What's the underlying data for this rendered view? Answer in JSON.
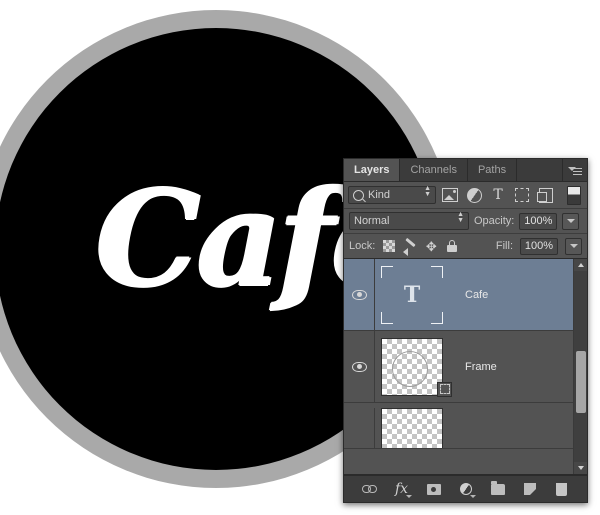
{
  "artwork": {
    "word": "Cafe",
    "ring_color": "#a9a9a9",
    "disc_color": "#000000",
    "text_color": "#ffffff",
    "background": "#ffffff"
  },
  "panel": {
    "tabs": [
      {
        "label": "Layers",
        "active": true
      },
      {
        "label": "Channels",
        "active": false
      },
      {
        "label": "Paths",
        "active": false
      }
    ],
    "menu_icon": "panel-menu-icon",
    "filter": {
      "kind_label": "Kind",
      "search_icon": "search-icon",
      "icons": [
        "pixel-layer-filter-icon",
        "adjustment-layer-filter-icon",
        "type-layer-filter-icon",
        "shape-layer-filter-icon",
        "smart-object-filter-icon"
      ],
      "type_glyph": "T",
      "toggle_icon": "filter-toggle-switch"
    },
    "blend": {
      "mode": "Normal",
      "opacity_label": "Opacity:",
      "opacity_value": "100%"
    },
    "lock": {
      "label": "Lock:",
      "icons": [
        "lock-transparent-pixels-icon",
        "lock-image-pixels-icon",
        "lock-position-icon",
        "lock-all-icon"
      ],
      "fill_label": "Fill:",
      "fill_value": "100%"
    },
    "layers": [
      {
        "name": "Cafe",
        "type": "type-layer",
        "visible": true,
        "selected": true,
        "thumb_glyph": "T"
      },
      {
        "name": "Frame",
        "type": "shape-layer",
        "visible": true,
        "selected": false,
        "badge": "vector-mask-badge"
      },
      {
        "name": "",
        "type": "shape-layer",
        "visible": true,
        "selected": false
      }
    ],
    "scrollbar": {
      "up_icon": "scroll-up-arrow",
      "down_icon": "scroll-down-arrow"
    },
    "bottom_bar": [
      "link-layers-icon",
      "layer-style-fx-icon",
      "add-layer-mask-icon",
      "new-adjustment-layer-icon",
      "new-group-icon",
      "new-layer-icon",
      "delete-layer-icon"
    ],
    "fx_glyph": "fx",
    "colors": {
      "panel_bg": "#535353",
      "tab_bg": "#3b3b3b",
      "selection": "#6d7e94",
      "bottom_bar": "#3c3c3c"
    }
  }
}
